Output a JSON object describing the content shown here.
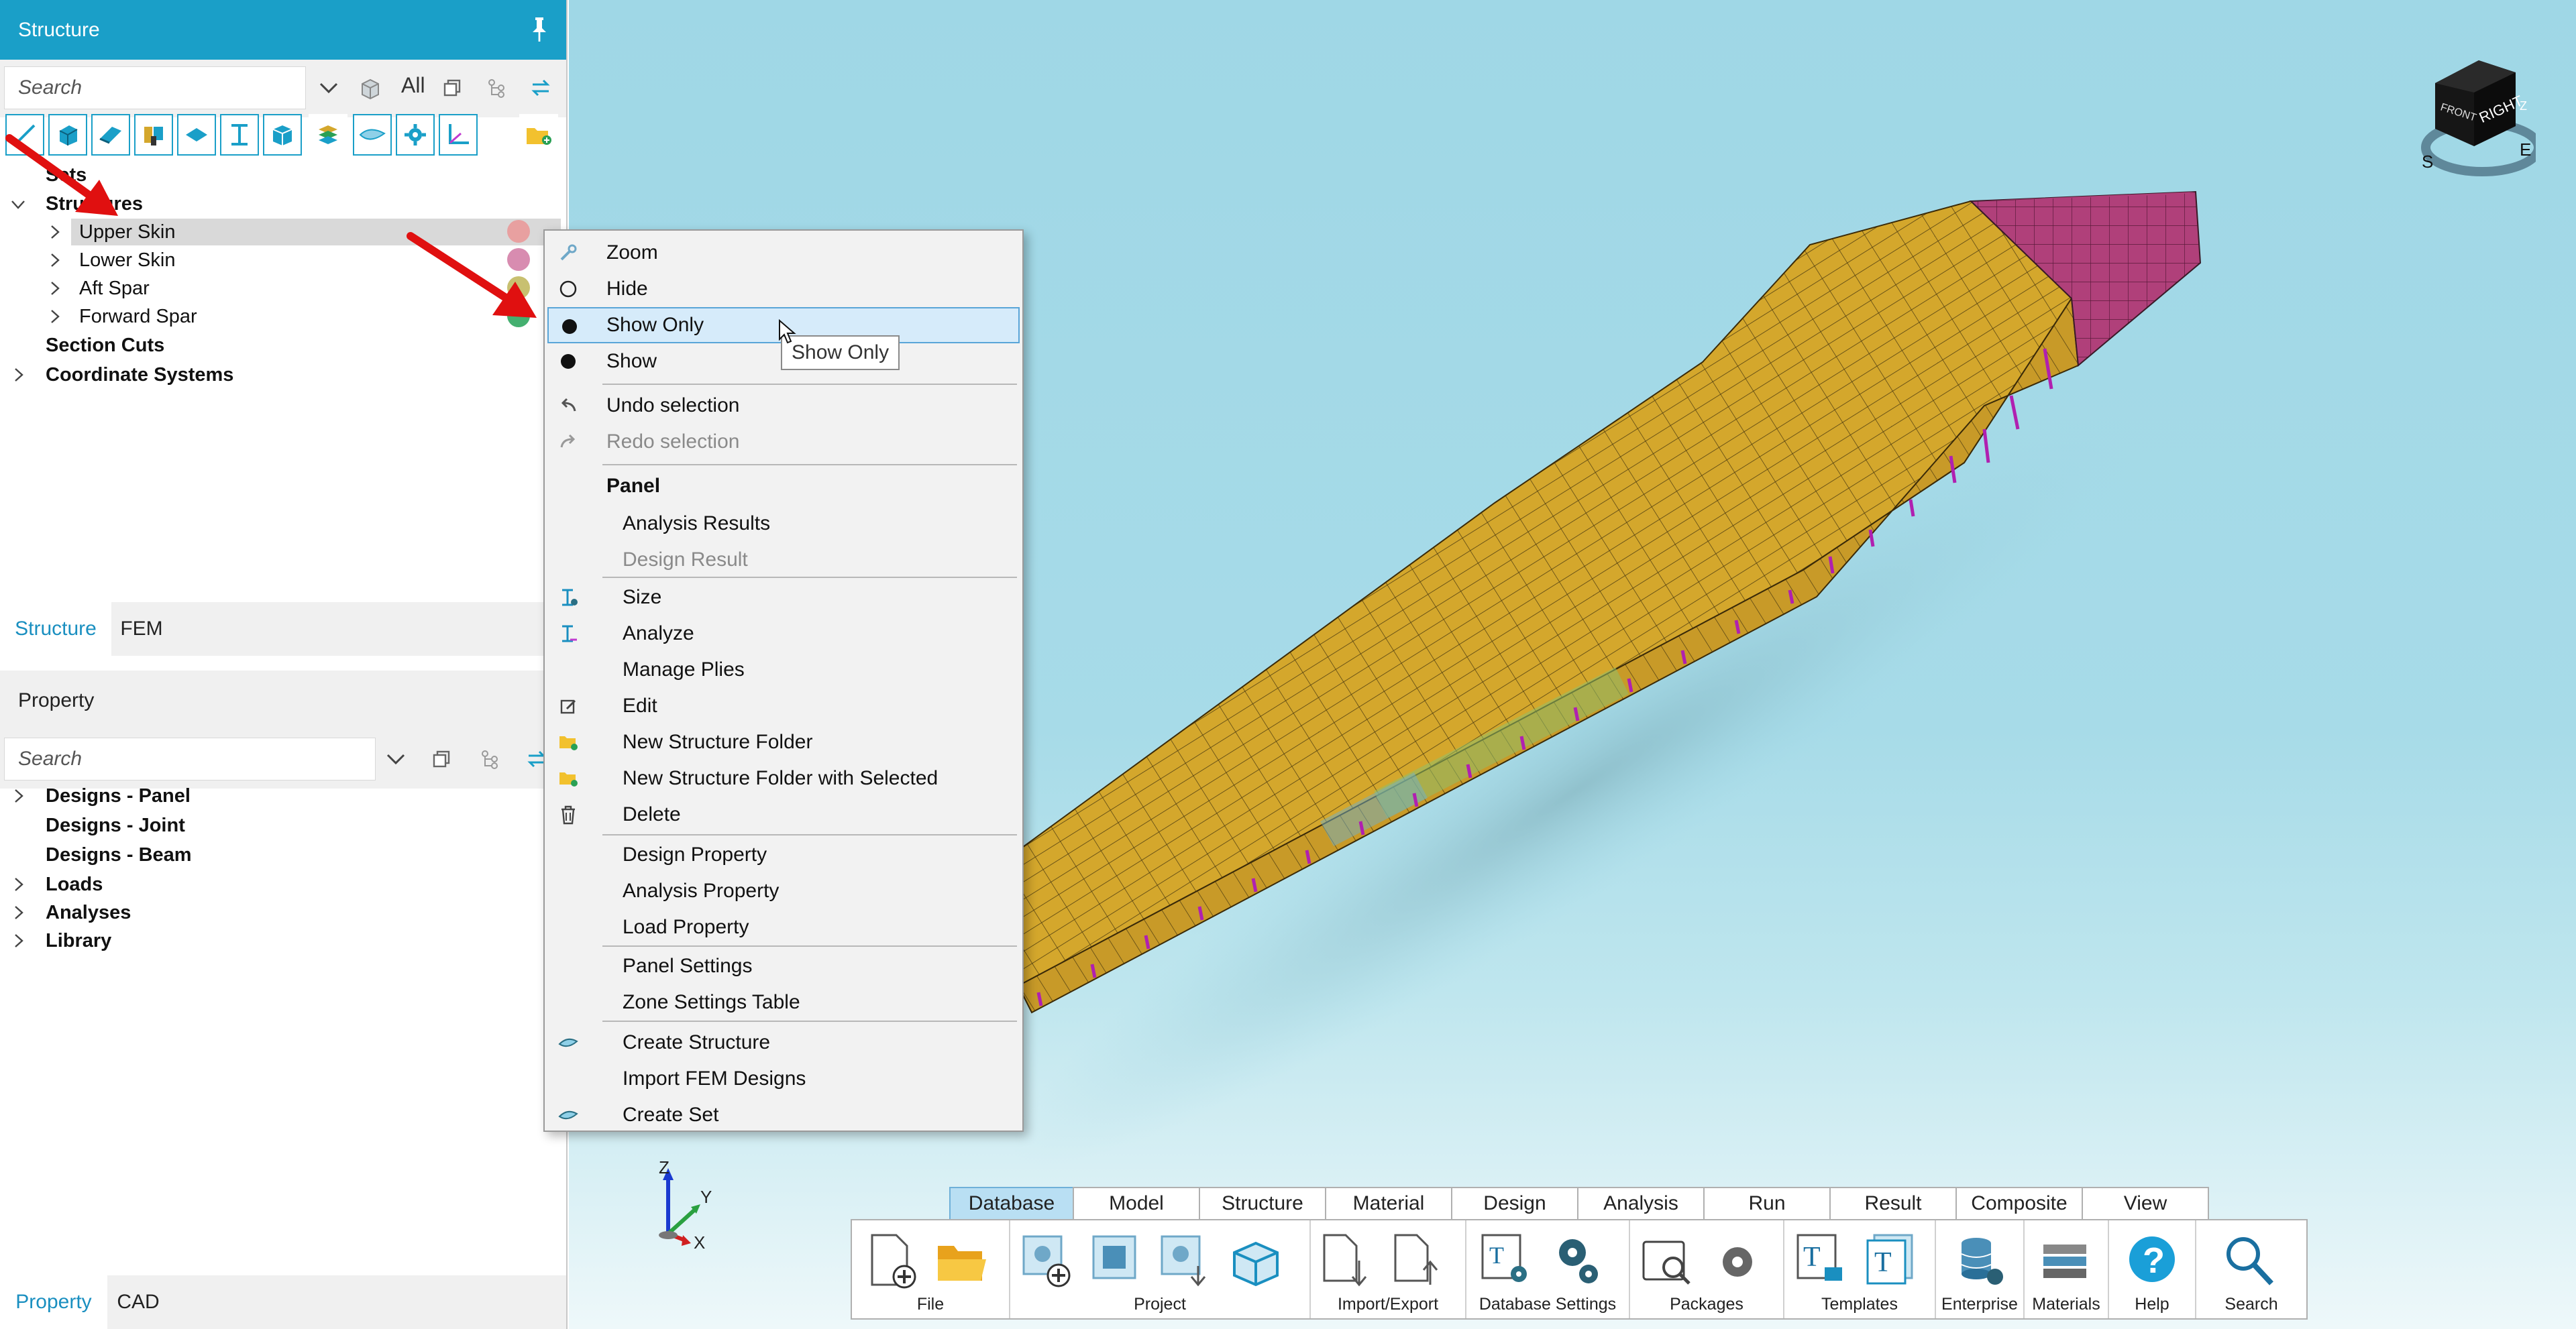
{
  "structure_panel": {
    "title": "Structure",
    "search_placeholder": "Search",
    "filter_all_label": "All",
    "tree": [
      {
        "label": "Sets",
        "bold": true
      },
      {
        "label": "Structures",
        "bold": true,
        "expanded": true
      },
      {
        "label": "Upper Skin",
        "selected": true,
        "color": "#e8a0a0"
      },
      {
        "label": "Lower Skin",
        "color": "#d88cb0"
      },
      {
        "label": "Aft Spar",
        "color": "#c8c070"
      },
      {
        "label": "Forward Spar",
        "color": "#44b070"
      },
      {
        "label": "Section Cuts",
        "bold": true
      },
      {
        "label": "Coordinate Systems",
        "bold": true
      }
    ],
    "tabs": [
      "Structure",
      "FEM"
    ],
    "active_tab": "Structure"
  },
  "property_panel": {
    "title": "Property",
    "search_placeholder": "Search",
    "tree": [
      {
        "label": "Designs - Panel"
      },
      {
        "label": "Designs - Joint"
      },
      {
        "label": "Designs - Beam"
      },
      {
        "label": "Loads"
      },
      {
        "label": "Analyses"
      },
      {
        "label": "Library"
      }
    ],
    "tabs": [
      "Property",
      "CAD"
    ],
    "active_tab": "Property"
  },
  "context_menu": {
    "items": {
      "zoom": "Zoom",
      "hide": "Hide",
      "show_only": "Show Only",
      "show": "Show",
      "undo_selection": "Undo selection",
      "redo_selection": "Redo selection",
      "panel_header": "Panel",
      "analysis_results": "Analysis Results",
      "design_result": "Design Result",
      "size": "Size",
      "analyze": "Analyze",
      "manage_plies": "Manage Plies",
      "edit": "Edit",
      "new_structure_folder": "New Structure Folder",
      "new_structure_folder_with_selected": "New Structure Folder with Selected",
      "delete": "Delete",
      "design_property": "Design Property",
      "analysis_property": "Analysis Property",
      "load_property": "Load Property",
      "panel_settings": "Panel Settings",
      "zone_settings_table": "Zone Settings Table",
      "create_structure": "Create Structure",
      "import_fem_designs": "Import FEM Designs",
      "create_set": "Create Set"
    },
    "highlighted": "Show Only"
  },
  "tooltip": "Show Only",
  "viewcube": {
    "front": "FRONT",
    "right": "RIGHT",
    "top": "Z",
    "compass": [
      "S",
      "E"
    ]
  },
  "axes": {
    "z": "Z",
    "y": "Y",
    "x": "X"
  },
  "ribbon": {
    "tabs": [
      "Database",
      "Model",
      "Structure",
      "Material",
      "Design",
      "Analysis",
      "Run",
      "Result",
      "Composite",
      "View"
    ],
    "active_tab": "Database",
    "groups": {
      "file": "File",
      "project": "Project",
      "import_export": "Import/Export",
      "database_settings": "Database Settings",
      "packages": "Packages",
      "templates": "Templates",
      "enterprise": "Enterprise",
      "materials": "Materials",
      "help": "Help",
      "search": "Search"
    }
  },
  "colors": {
    "accent": "#1a9fc8",
    "mesh_gold": "#d4a72c",
    "mesh_magenta": "#b0407a",
    "annotation_arrow": "#e01010"
  }
}
